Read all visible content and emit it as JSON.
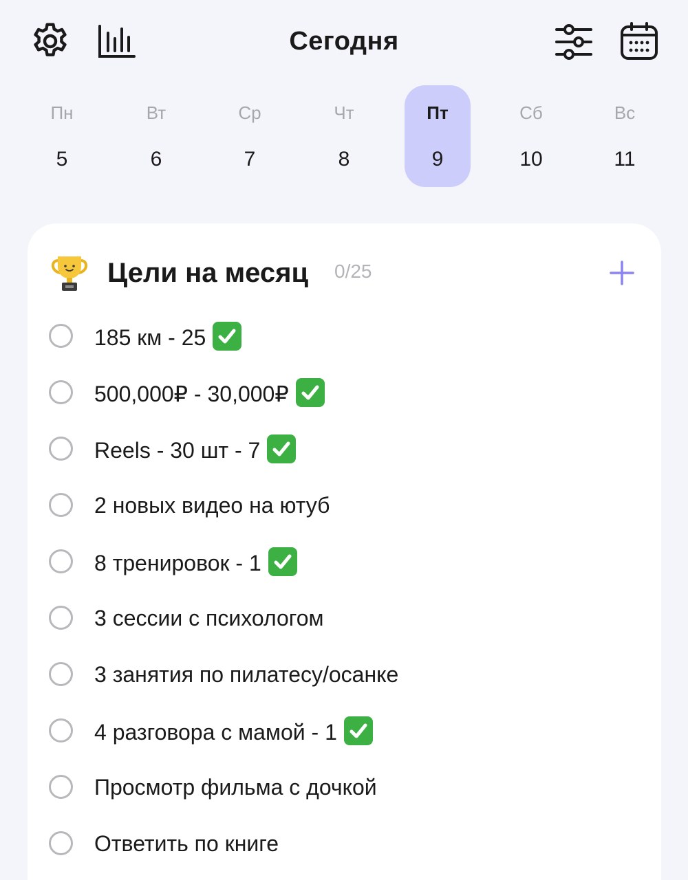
{
  "header": {
    "title": "Сегодня",
    "icons": [
      "gear-icon",
      "bar-chart-icon",
      "sliders-icon",
      "calendar-icon"
    ]
  },
  "week": {
    "days": [
      {
        "name": "Пн",
        "num": "5"
      },
      {
        "name": "Вт",
        "num": "6"
      },
      {
        "name": "Ср",
        "num": "7"
      },
      {
        "name": "Чт",
        "num": "8"
      },
      {
        "name": "Пт",
        "num": "9"
      },
      {
        "name": "Сб",
        "num": "10"
      },
      {
        "name": "Вс",
        "num": "11"
      }
    ],
    "selected_index": 4
  },
  "goals_card": {
    "title": "Цели на месяц",
    "count": "0/25",
    "icon": "trophy-icon",
    "add_icon": "plus-icon",
    "items": [
      {
        "text": "185 км - 25",
        "done_mark": true
      },
      {
        "text": "500,000₽ - 30,000₽",
        "done_mark": true
      },
      {
        "text": "Reels - 30 шт - 7",
        "done_mark": true
      },
      {
        "text": "2 новых видео на ютуб",
        "done_mark": false
      },
      {
        "text": "8 тренировок - 1",
        "done_mark": true
      },
      {
        "text": "3 сессии с психологом",
        "done_mark": false
      },
      {
        "text": "3 занятия по пилатесу/осанке",
        "done_mark": false
      },
      {
        "text": "4 разговора с мамой - 1",
        "done_mark": true
      },
      {
        "text": "Просмотр фильма с дочкой",
        "done_mark": false
      },
      {
        "text": "Ответить по книге",
        "done_mark": false
      }
    ]
  },
  "colors": {
    "background": "#f4f4fb",
    "selected_day": "#cdcdfb",
    "accent": "#8b84f0",
    "check_emoji": "#3cb043"
  }
}
